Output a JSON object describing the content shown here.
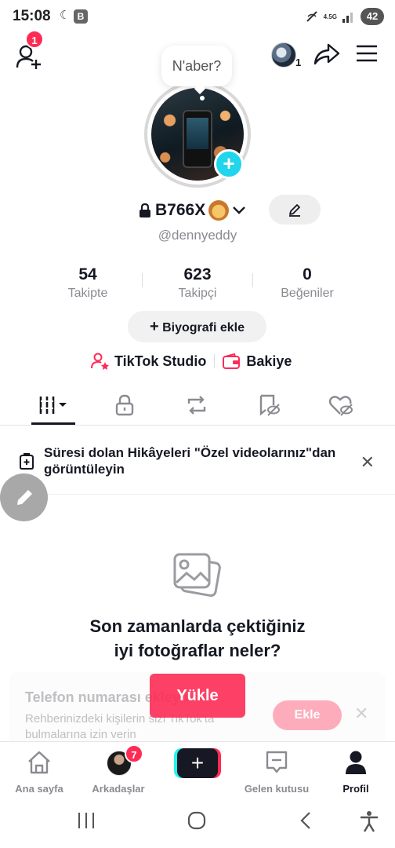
{
  "status_bar": {
    "time": "15:08",
    "notif_letter": "B",
    "network": "4.5G",
    "battery": "42"
  },
  "top_bar": {
    "add_friend_badge": "1",
    "account_count": "1"
  },
  "profile": {
    "note_bubble": "N'aber?",
    "display_name": "B766X",
    "username": "@dennyeddy"
  },
  "stats": [
    {
      "value": "54",
      "label": "Takipte"
    },
    {
      "value": "623",
      "label": "Takipçi"
    },
    {
      "value": "0",
      "label": "Beğeniler"
    }
  ],
  "actions": {
    "add_bio": "Biyografi ekle",
    "studio": "TikTok Studio",
    "balance": "Bakiye"
  },
  "banner": {
    "text": "Süresi dolan Hikâyeleri \"Özel videolarınız\"dan görüntüleyin"
  },
  "empty_state": {
    "title_line1": "Son zamanlarda çektiğiniz",
    "title_line2": "iyi fotoğraflar neler?",
    "upload_label": "Yükle"
  },
  "contact_card": {
    "title": "Telefon numarası ekleyin",
    "description": "Rehberinizdeki kişilerin sizi TikTok'ta bulmalarına izin verin",
    "button": "Ekle"
  },
  "bottom_nav": {
    "home": "Ana sayfa",
    "friends": "Arkadaşlar",
    "friends_badge": "7",
    "inbox": "Gelen kutusu",
    "profile": "Profil"
  },
  "colors": {
    "accent": "#fe2c55",
    "cyan": "#20d5ec",
    "text": "#161823",
    "muted": "#8a8b91"
  }
}
